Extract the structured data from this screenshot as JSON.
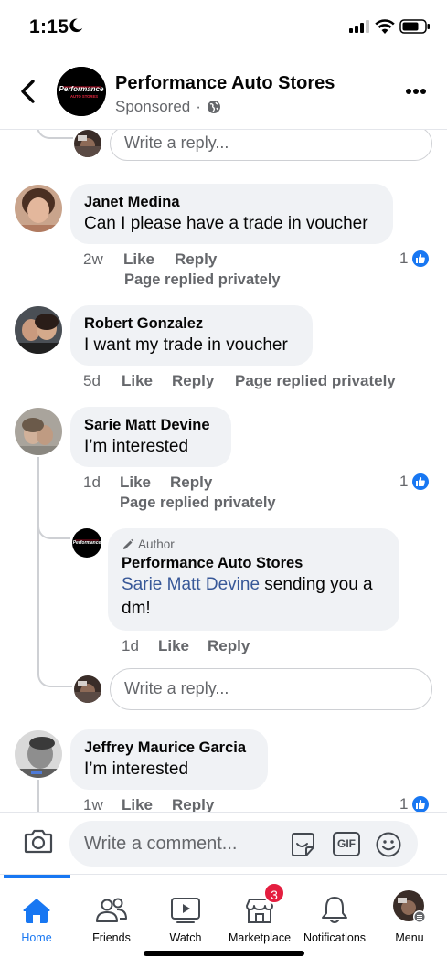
{
  "status_bar": {
    "time": "1:15"
  },
  "header": {
    "page_name": "Performance Auto Stores",
    "sponsored": "Sponsored",
    "separator": "·",
    "logo_text_top": "Performance",
    "logo_text_bottom": "AUTO STORES"
  },
  "reply_placeholder": "Write a reply...",
  "comments": [
    {
      "name": "Janet Medina",
      "text": "Can I please have a trade in voucher",
      "time": "2w",
      "like": "Like",
      "reply": "Reply",
      "sub": "Page replied privately",
      "reactions": "1"
    },
    {
      "name": "Robert Gonzalez",
      "text": "I want my trade in voucher",
      "time": "5d",
      "like": "Like",
      "reply": "Reply",
      "sub": "Page replied privately"
    },
    {
      "name": "Sarie Matt Devine",
      "text": "I’m interested",
      "time": "1d",
      "like": "Like",
      "reply": "Reply",
      "sub": "Page replied privately",
      "reactions": "1"
    },
    {
      "name": "Jeffrey Maurice Garcia",
      "text": "I’m interested",
      "time": "1w",
      "like": "Like",
      "reply": "Reply",
      "reactions": "1"
    }
  ],
  "author_reply": {
    "tag": "Author",
    "name": "Performance Auto Stores",
    "mention": "Sarie Matt Devine",
    "text_rest": " sending you a",
    "text_line2": "dm!",
    "time": "1d",
    "like": "Like",
    "reply": "Reply"
  },
  "composer": {
    "placeholder": "Write a comment...",
    "gif": "GIF"
  },
  "tabs": [
    {
      "label": "Home",
      "icon": "home-icon",
      "active": true
    },
    {
      "label": "Friends",
      "icon": "friends-icon"
    },
    {
      "label": "Watch",
      "icon": "watch-icon"
    },
    {
      "label": "Marketplace",
      "icon": "marketplace-icon",
      "badge": "3"
    },
    {
      "label": "Notifications",
      "icon": "bell-icon"
    },
    {
      "label": "Menu",
      "icon": "menu-icon"
    }
  ],
  "colors": {
    "accent": "#1877f2",
    "link": "#385898",
    "bubble": "#f0f2f5",
    "badge": "#e41e3f"
  }
}
